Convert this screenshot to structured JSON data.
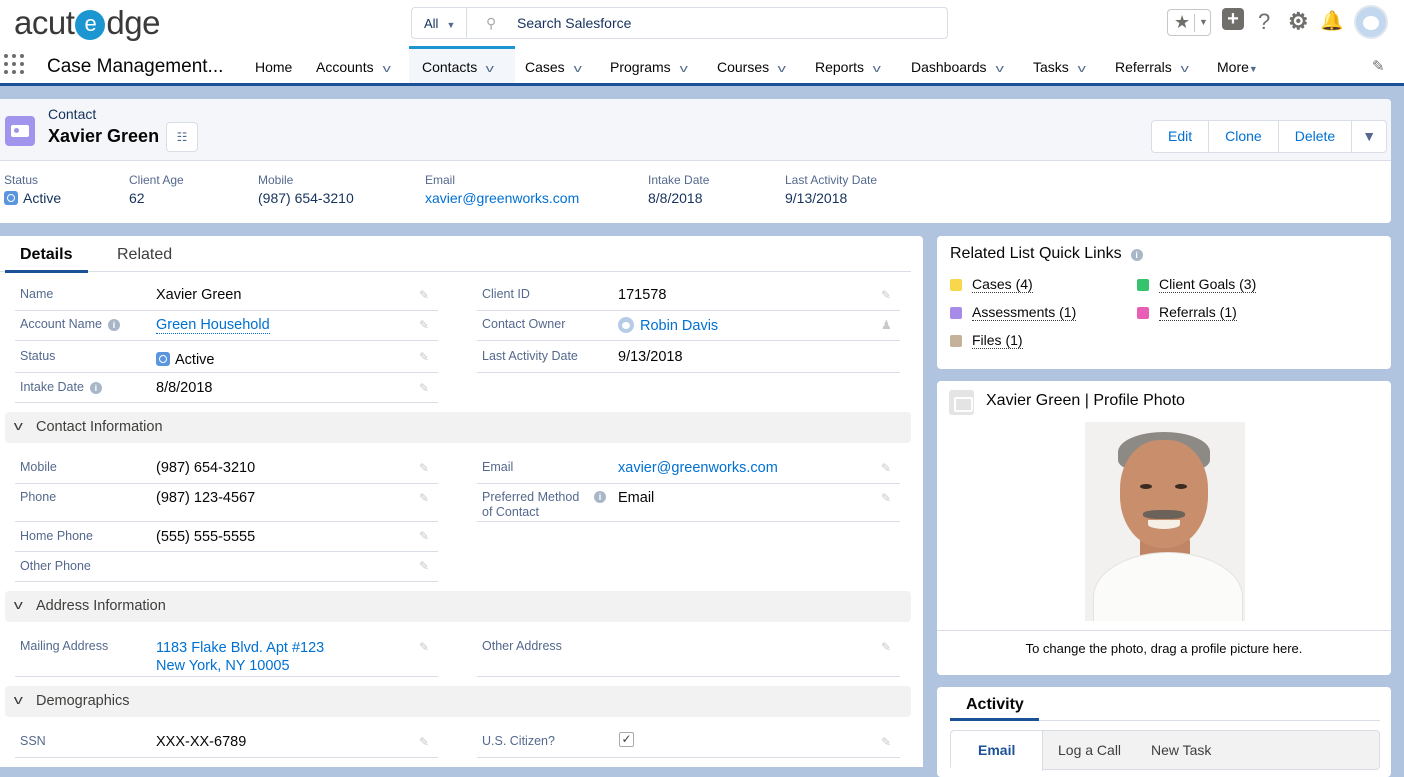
{
  "topbar": {
    "logo_pre": "acut",
    "logo_e": "e",
    "logo_post": "dge",
    "search_scope": "All",
    "search_placeholder": "Search Salesforce",
    "icons": [
      "star-icon",
      "plus-icon",
      "help-icon",
      "gear-icon",
      "bell-icon",
      "avatar"
    ]
  },
  "nav": {
    "app_name": "Case Management...",
    "items": [
      {
        "label": "Home"
      },
      {
        "label": "Accounts"
      },
      {
        "label": "Contacts"
      },
      {
        "label": "Cases"
      },
      {
        "label": "Programs"
      },
      {
        "label": "Courses"
      },
      {
        "label": "Reports"
      },
      {
        "label": "Dashboards"
      },
      {
        "label": "Tasks"
      },
      {
        "label": "Referrals"
      },
      {
        "label": "More"
      }
    ],
    "active": "Contacts"
  },
  "header": {
    "object_type": "Contact",
    "record_name": "Xavier Green",
    "buttons": {
      "edit": "Edit",
      "clone": "Clone",
      "delete": "Delete"
    },
    "fields": [
      {
        "label": "Status",
        "value": "Active"
      },
      {
        "label": "Client Age",
        "value": "62"
      },
      {
        "label": "Mobile",
        "value": "(987) 654-3210"
      },
      {
        "label": "Email",
        "value": "xavier@greenworks.com"
      },
      {
        "label": "Intake Date",
        "value": "8/8/2018"
      },
      {
        "label": "Last Activity Date",
        "value": "9/13/2018"
      }
    ]
  },
  "tabs": {
    "details": "Details",
    "related": "Related"
  },
  "details": {
    "name_lbl": "Name",
    "name_val": "Xavier Green",
    "account_lbl": "Account Name",
    "account_val": "Green Household",
    "status_lbl": "Status",
    "status_val": "Active",
    "intake_lbl": "Intake Date",
    "intake_val": "8/8/2018",
    "clientid_lbl": "Client ID",
    "clientid_val": "171578",
    "owner_lbl": "Contact Owner",
    "owner_val": "Robin Davis",
    "lastact_lbl": "Last Activity Date",
    "lastact_val": "9/13/2018"
  },
  "contact_info": {
    "title": "Contact Information",
    "mobile_lbl": "Mobile",
    "mobile_val": "(987) 654-3210",
    "phone_lbl": "Phone",
    "phone_val": "(987) 123-4567",
    "home_lbl": "Home Phone",
    "home_val": "(555) 555-5555",
    "other_lbl": "Other Phone",
    "email_lbl": "Email",
    "email_val": "xavier@greenworks.com",
    "pref_lbl_1": "Preferred Method",
    "pref_lbl_2": "of Contact",
    "pref_val": "Email"
  },
  "address": {
    "title": "Address Information",
    "mailing_lbl": "Mailing Address",
    "mailing_line1": "1183 Flake Blvd. Apt #123",
    "mailing_line2": "New York, NY 10005",
    "other_lbl": "Other Address"
  },
  "demographics": {
    "title": "Demographics",
    "ssn_lbl": "SSN",
    "ssn_val": "XXX-XX-6789",
    "citizen_lbl": "U.S. Citizen?",
    "citizen_checked": true
  },
  "quick_links": {
    "title": "Related List Quick Links",
    "links": [
      {
        "label": "Cases (4)",
        "color": "#f9d74d"
      },
      {
        "label": "Client Goals (3)",
        "color": "#35c36d"
      },
      {
        "label": "Assessments (1)",
        "color": "#a68ce8"
      },
      {
        "label": "Referrals (1)",
        "color": "#e85fb5"
      },
      {
        "label": "Files (1)",
        "color": "#c4b39a"
      }
    ]
  },
  "profile_photo": {
    "title": "Xavier Green | Profile Photo",
    "footer": "To change the photo, drag a profile picture here."
  },
  "activity": {
    "title": "Activity",
    "tabs": [
      "Email",
      "Log a Call",
      "New Task"
    ]
  }
}
